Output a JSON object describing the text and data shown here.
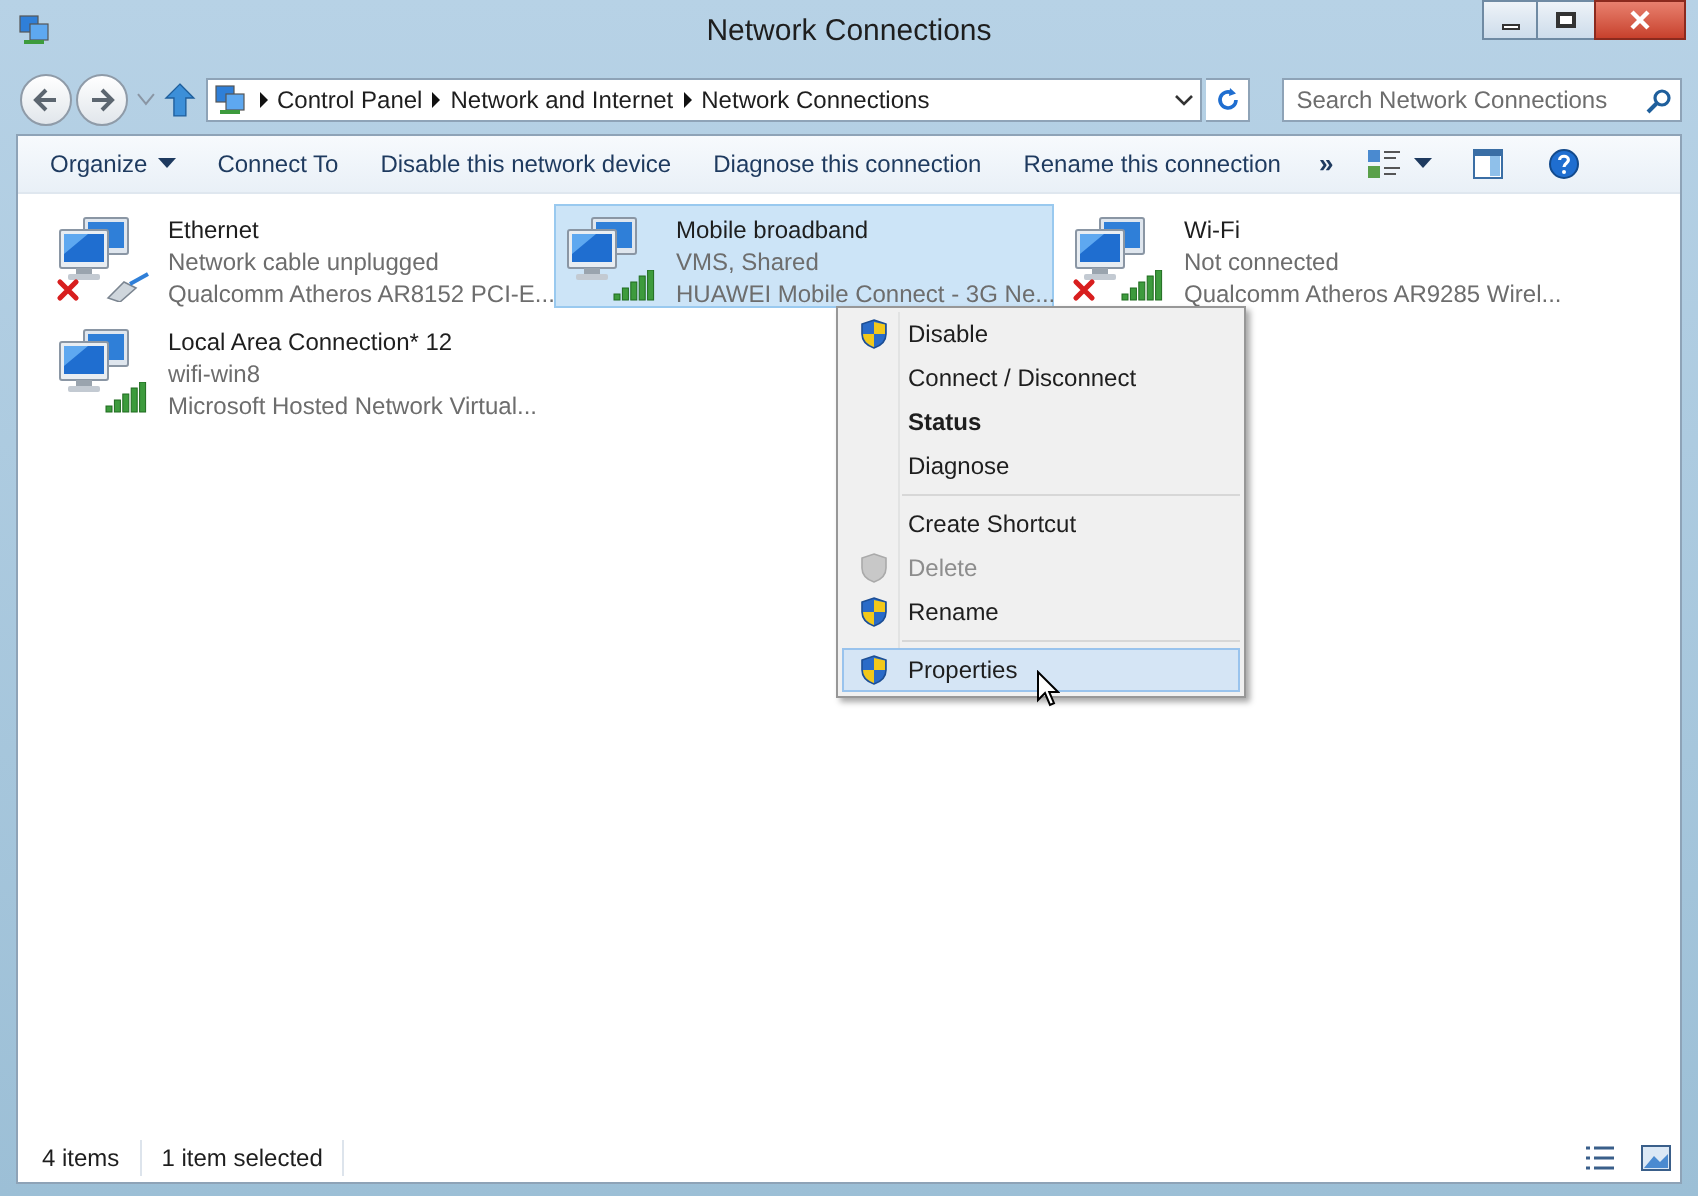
{
  "window": {
    "title": "Network Connections"
  },
  "address": {
    "crumbs": [
      "Control Panel",
      "Network and Internet",
      "Network Connections"
    ]
  },
  "search": {
    "placeholder": "Search Network Connections"
  },
  "toolbar": [
    {
      "label": "Organize",
      "dropdown": true
    },
    {
      "label": "Connect To",
      "dropdown": false
    },
    {
      "label": "Disable this network device",
      "dropdown": false
    },
    {
      "label": "Diagnose this connection",
      "dropdown": false
    },
    {
      "label": "Rename this connection",
      "dropdown": false
    }
  ],
  "overflow": "»",
  "connections": [
    {
      "name": "Ethernet",
      "status": "Network cable unplugged",
      "adapter": "Qualcomm Atheros AR8152 PCI-E...",
      "kind": "wired",
      "disconnected": true,
      "selected": false
    },
    {
      "name": "Mobile broadband",
      "status": "VMS, Shared",
      "adapter": "HUAWEI Mobile Connect - 3G Ne...",
      "kind": "wireless",
      "disconnected": false,
      "selected": true
    },
    {
      "name": "Wi-Fi",
      "status": "Not connected",
      "adapter": "Qualcomm Atheros AR9285 Wirel...",
      "kind": "wireless",
      "disconnected": true,
      "selected": false
    },
    {
      "name": "Local Area Connection* 12",
      "status": "wifi-win8",
      "adapter": "Microsoft Hosted Network Virtual...",
      "kind": "wireless",
      "disconnected": false,
      "selected": false
    }
  ],
  "context_menu": [
    {
      "kind": "item",
      "label": "Disable",
      "shield": true,
      "default": false,
      "disabled": false,
      "selected": false
    },
    {
      "kind": "item",
      "label": "Connect / Disconnect",
      "shield": false,
      "default": false,
      "disabled": false,
      "selected": false
    },
    {
      "kind": "item",
      "label": "Status",
      "shield": false,
      "default": true,
      "disabled": false,
      "selected": false
    },
    {
      "kind": "item",
      "label": "Diagnose",
      "shield": false,
      "default": false,
      "disabled": false,
      "selected": false
    },
    {
      "kind": "separator"
    },
    {
      "kind": "item",
      "label": "Create Shortcut",
      "shield": false,
      "default": false,
      "disabled": false,
      "selected": false
    },
    {
      "kind": "item",
      "label": "Delete",
      "shield": true,
      "default": false,
      "disabled": true,
      "selected": false
    },
    {
      "kind": "item",
      "label": "Rename",
      "shield": true,
      "default": false,
      "disabled": false,
      "selected": false
    },
    {
      "kind": "separator"
    },
    {
      "kind": "item",
      "label": "Properties",
      "shield": true,
      "default": false,
      "disabled": false,
      "selected": true
    }
  ],
  "status_bar": {
    "count": "4 items",
    "selection": "1 item selected"
  }
}
